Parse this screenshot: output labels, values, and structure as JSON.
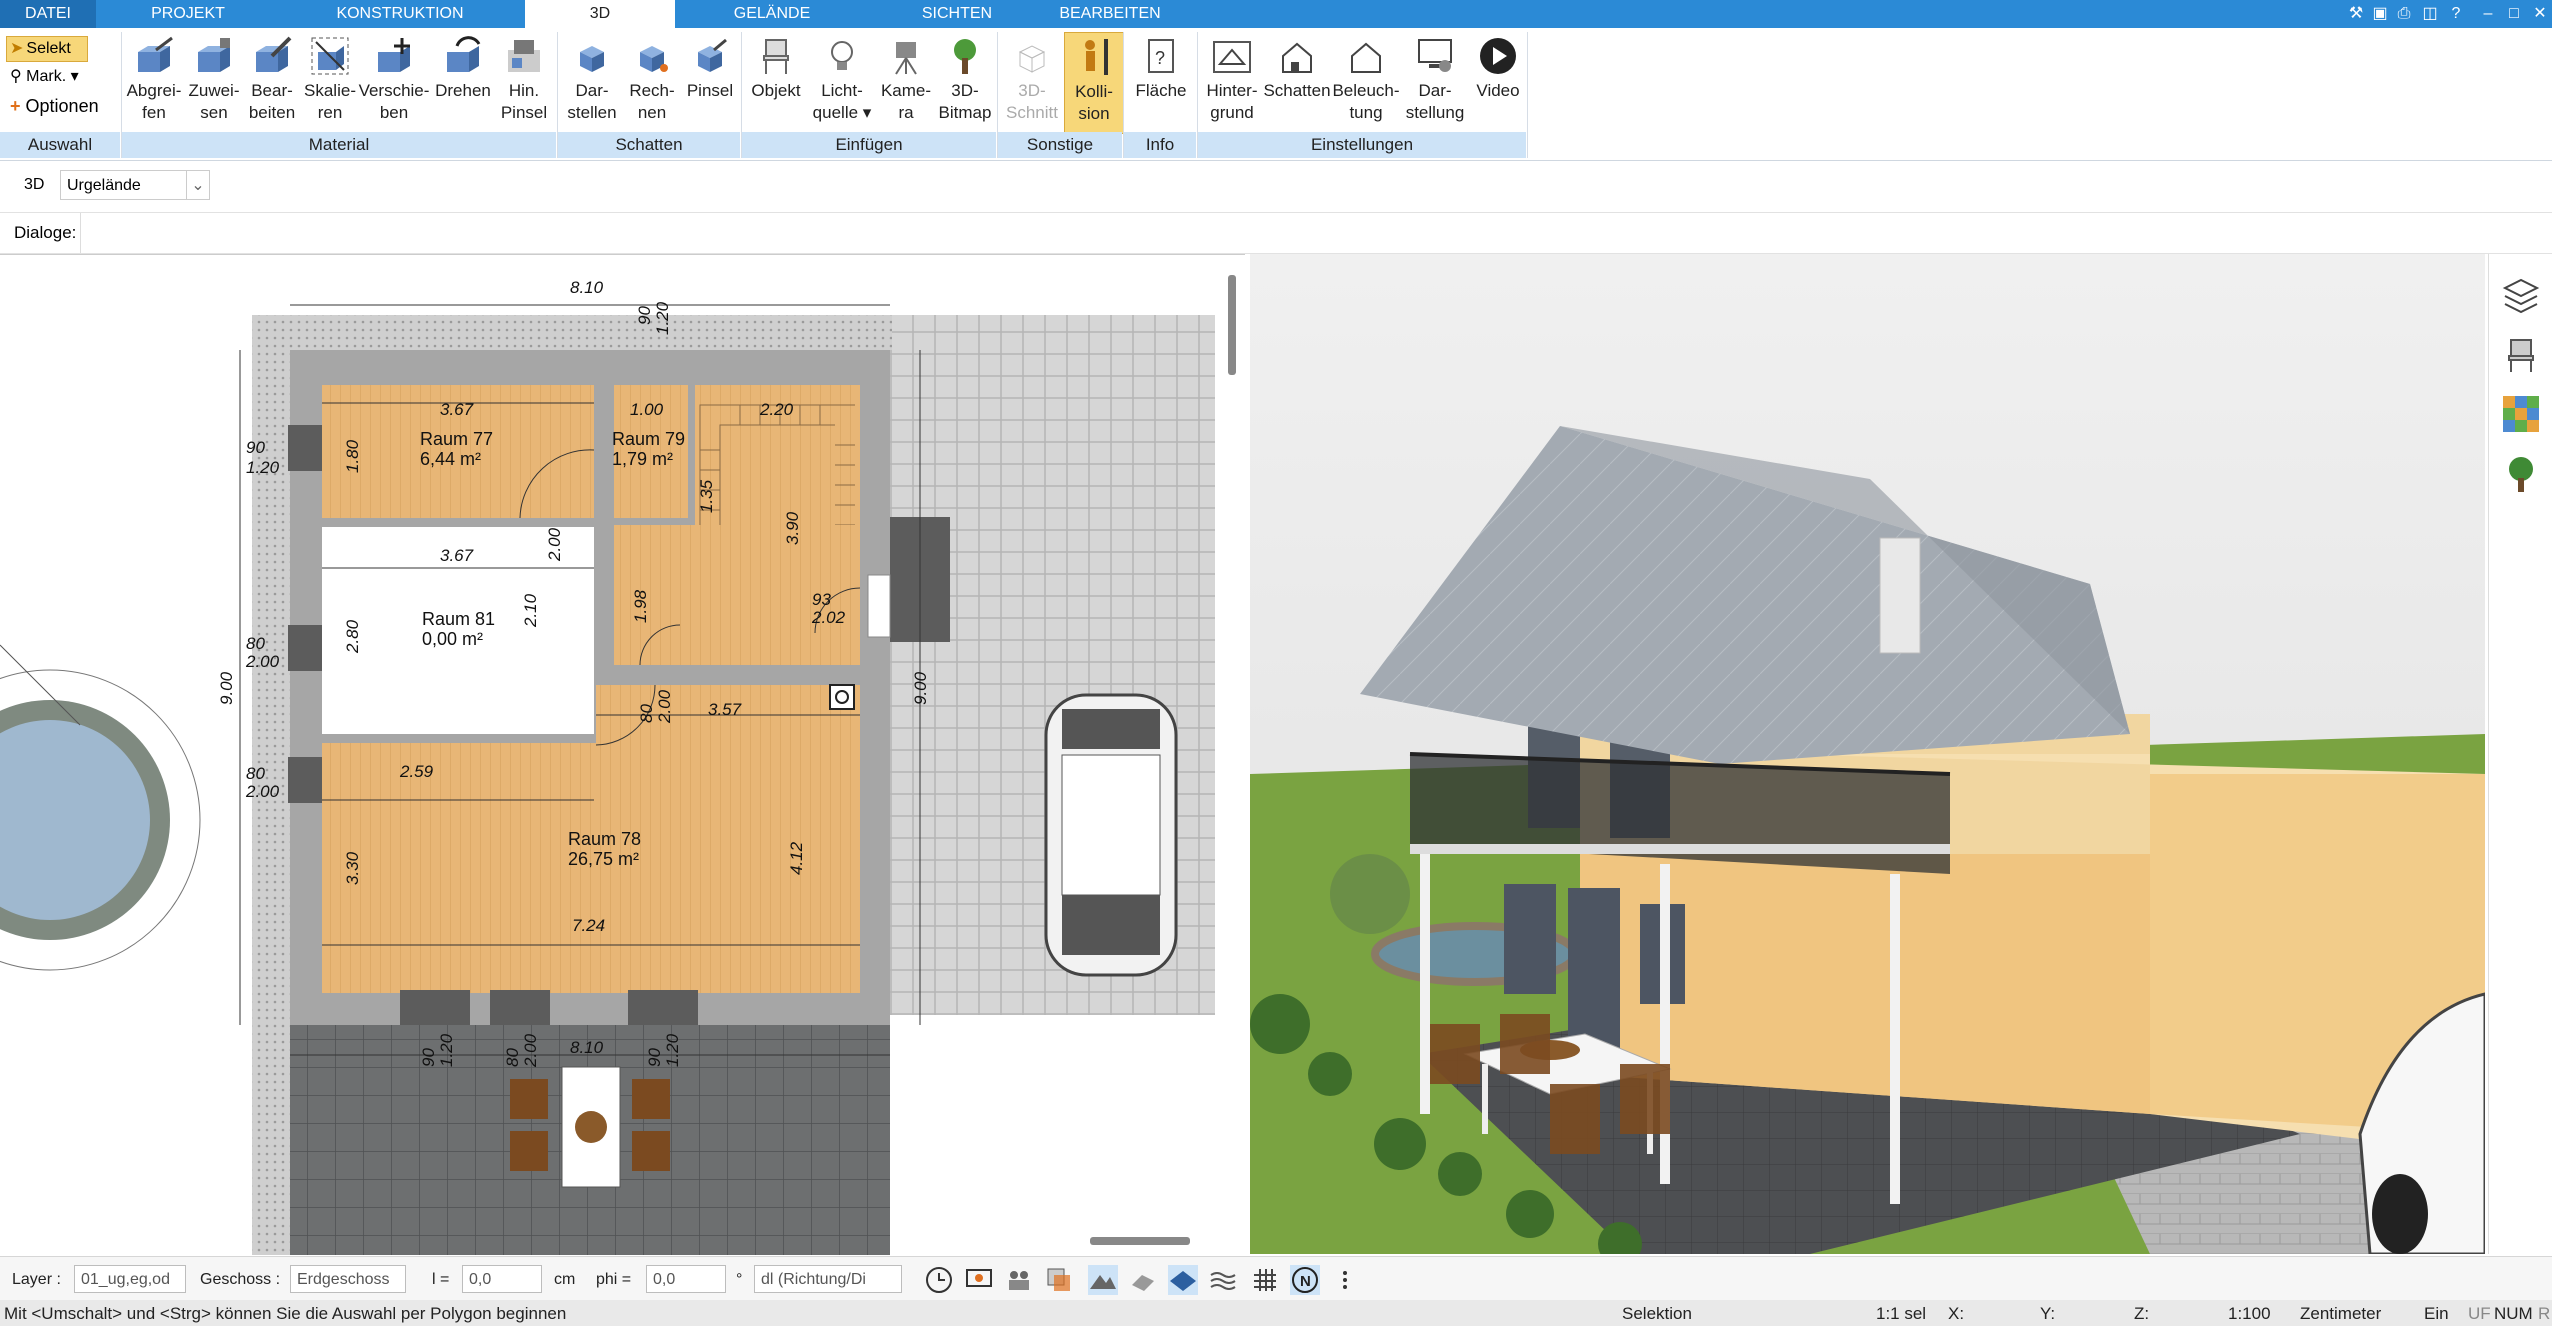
{
  "tabs": {
    "datei": "DATEI",
    "projekt": "PROJEKT",
    "konstruktion": "KONSTRUKTION",
    "d3": "3D",
    "gelaende": "GELÄNDE",
    "sichten": "SICHTEN",
    "bearbeiten": "BEARBEITEN"
  },
  "ribbon": {
    "auswahl": {
      "selekt": "Selekt",
      "mark": "Mark.",
      "optionen": "Optionen",
      "group": "Auswahl"
    },
    "material": {
      "group": "Material",
      "items": [
        {
          "l1": "Abgrei-",
          "l2": "fen"
        },
        {
          "l1": "Zuwei-",
          "l2": "sen"
        },
        {
          "l1": "Bear-",
          "l2": "beiten"
        },
        {
          "l1": "Skalie-",
          "l2": "ren"
        },
        {
          "l1": "Verschie-",
          "l2": "ben"
        },
        {
          "l1": "Drehen",
          "l2": ""
        },
        {
          "l1": "Hin.",
          "l2": "Pinsel"
        }
      ]
    },
    "schatten": {
      "group": "Schatten",
      "items": [
        {
          "l1": "Dar-",
          "l2": "stellen"
        },
        {
          "l1": "Rech-",
          "l2": "nen"
        },
        {
          "l1": "Pinsel",
          "l2": ""
        }
      ]
    },
    "einfuegen": {
      "group": "Einfügen",
      "items": [
        {
          "l1": "Objekt",
          "l2": ""
        },
        {
          "l1": "Licht-",
          "l2": "quelle"
        },
        {
          "l1": "Kame-",
          "l2": "ra"
        },
        {
          "l1": "3D-",
          "l2": "Bitmap"
        }
      ]
    },
    "sonstige": {
      "group": "Sonstige",
      "items": [
        {
          "l1": "3D-",
          "l2": "Schnitt"
        },
        {
          "l1": "Kolli-",
          "l2": "sion"
        }
      ]
    },
    "info": {
      "group": "Info",
      "items": [
        {
          "l1": "Fläche",
          "l2": ""
        }
      ]
    },
    "einstellungen": {
      "group": "Einstellungen",
      "items": [
        {
          "l1": "Hinter-",
          "l2": "grund"
        },
        {
          "l1": "Schatten",
          "l2": ""
        },
        {
          "l1": "Beleuch-",
          "l2": "tung"
        },
        {
          "l1": "Dar-",
          "l2": "stellung"
        },
        {
          "l1": "Video",
          "l2": ""
        }
      ]
    }
  },
  "row3d": {
    "label": "3D",
    "select": "Urgelände"
  },
  "dialoge": {
    "label": "Dialoge:"
  },
  "plan": {
    "dims": {
      "top_810": "8.10",
      "top_90": "90",
      "top_120": "1.20",
      "r77_w": "3.67",
      "r77_h": "1.80",
      "r79_w": "1.00",
      "stair_w": "2.20",
      "left_90": "90",
      "left_120": "1.20",
      "r81_w": "3.67",
      "r81_h": "2.80",
      "r81_h2": "2.10",
      "left_80a": "80",
      "left_200a": "2.00",
      "left_80b": "80",
      "left_200b": "2.00",
      "h_900": "9.00",
      "h_900r": "9.00",
      "d357": "3.57",
      "d259": "2.59",
      "d330": "3.30",
      "d412": "4.12",
      "d724": "7.24",
      "d80c": "80",
      "d200c": "2.00",
      "d93": "93",
      "d202": "2.02",
      "d135": "1.35",
      "d390": "3.90",
      "d198": "1.98",
      "d200d": "2.00",
      "bot_810": "8.10",
      "bot_90a": "90",
      "bot_120a": "1.20",
      "bot_80": "80",
      "bot_200": "2.00",
      "bot_90b": "90",
      "bot_120b": "1.20"
    },
    "rooms": {
      "r77_name": "Raum 77",
      "r77_area": "6,44 m²",
      "r79_name": "Raum 79",
      "r79_area": "1,79 m²",
      "r81_name": "Raum 81",
      "r81_area": "0,00 m²",
      "r78_name": "Raum 78",
      "r78_area": "26,75 m²"
    }
  },
  "bottom": {
    "layer_label": "Layer :",
    "layer_value": "01_ug,eg,od",
    "geschoss_label": "Geschoss :",
    "geschoss_value": "Erdgeschoss",
    "l_label": "l =",
    "l_value": "0,0",
    "l_unit": "cm",
    "phi_label": "phi =",
    "phi_value": "0,0",
    "phi_unit": "°",
    "dl_value": "dl (Richtung/Di"
  },
  "status": {
    "hint": "Mit <Umschalt> und <Strg> können Sie die Auswahl per Polygon beginnen",
    "mode": "Selektion",
    "sel": "1:1 sel",
    "x": "X:",
    "y": "Y:",
    "z": "Z:",
    "scale": "1:100",
    "unit": "Zentimeter",
    "ein": "Ein",
    "uf": "UF",
    "num": "NUM",
    "r": "R"
  },
  "colors": {
    "accent": "#2b8ad6",
    "group_bg": "#cde3f7",
    "floor": "#e7b97f",
    "wall": "#9a9a9a",
    "roof": "#9ea6ae",
    "house": "#f3d9a4",
    "grass": "#7aa341"
  }
}
